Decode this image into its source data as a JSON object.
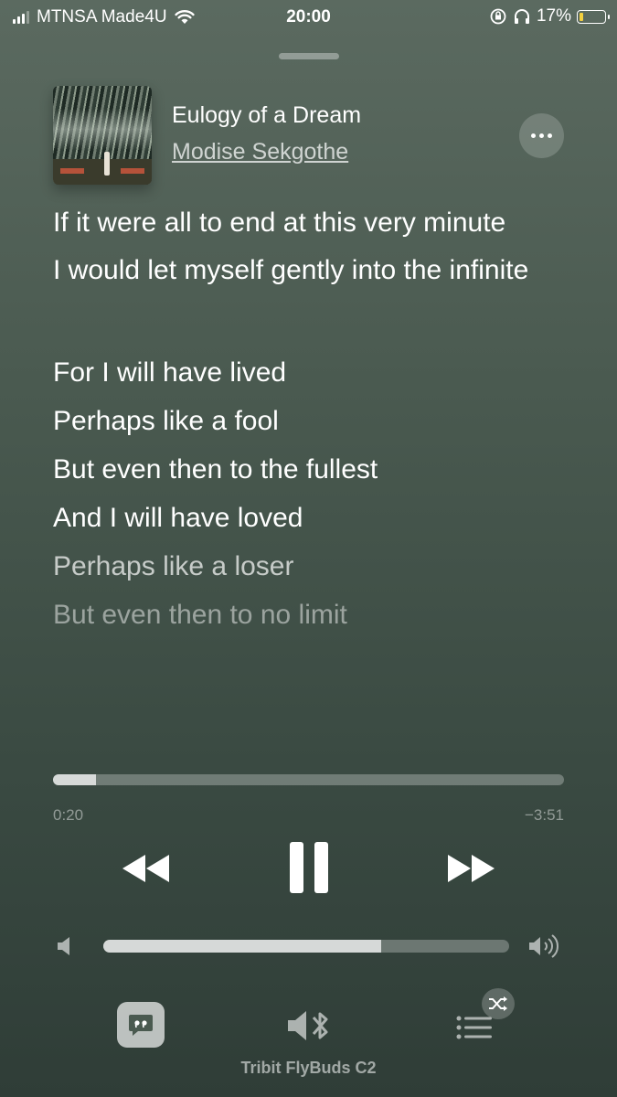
{
  "status_bar": {
    "carrier": "MTNSA Made4U",
    "time": "20:00",
    "battery_percent": "17%",
    "battery_level": 0.17,
    "battery_color": "#f4d03f",
    "icons": [
      "signal-icon",
      "wifi-icon",
      "orientation-lock-icon",
      "headphones-icon",
      "battery-icon"
    ]
  },
  "now_playing": {
    "title": "Eulogy of a Dream",
    "artist": "Modise Sekgothe",
    "more_icon": "ellipsis-icon"
  },
  "lyrics": [
    "If it were all to end at this very minute",
    "I would let myself gently into the infinite",
    "For I will have lived",
    "Perhaps like a fool",
    "But even then to the fullest",
    "And I will have loved",
    "Perhaps like a loser",
    "But even then to no limit"
  ],
  "playback": {
    "elapsed": "0:20",
    "remaining": "−3:51",
    "progress": 0.084,
    "state": "playing"
  },
  "controls": {
    "rewind_icon": "rewind-icon",
    "pause_icon": "pause-icon",
    "fast_forward_icon": "fast-forward-icon"
  },
  "volume": {
    "level": 0.685,
    "low_icon": "volume-low-icon",
    "high_icon": "volume-high-icon"
  },
  "bottom_bar": {
    "lyrics_icon": "lyrics-quote-icon",
    "output_icon": "bluetooth-speaker-icon",
    "output_device": "Tribit FlyBuds C2",
    "queue_icon": "queue-list-icon",
    "shuffle_icon": "shuffle-icon"
  }
}
